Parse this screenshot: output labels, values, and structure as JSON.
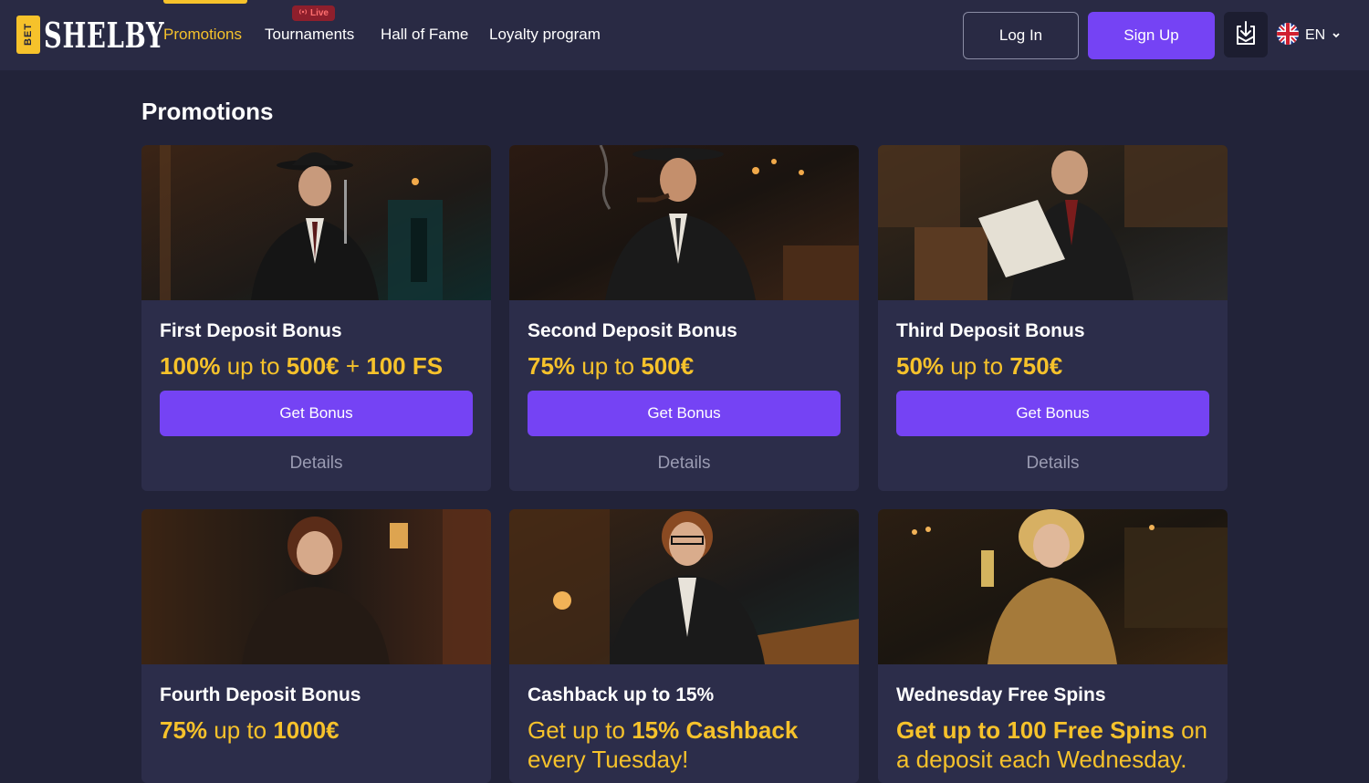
{
  "header": {
    "logo_text": "SHELBY",
    "logo_bet": "BET",
    "nav": [
      {
        "label": "Promotions",
        "active": true
      },
      {
        "label": "Tournaments",
        "badge": "Live"
      },
      {
        "label": "Hall of Fame"
      },
      {
        "label": "Loyalty program"
      }
    ],
    "login_label": "Log In",
    "signup_label": "Sign Up",
    "language": "EN"
  },
  "page": {
    "title": "Promotions"
  },
  "promos": [
    {
      "title": "First Deposit Bonus",
      "offer_parts": [
        [
          "b",
          "100%"
        ],
        [
          "n",
          " up to "
        ],
        [
          "b",
          "500€"
        ],
        [
          "n",
          " + "
        ],
        [
          "b",
          "100 FS"
        ]
      ],
      "button": "Get Bonus",
      "details": "Details"
    },
    {
      "title": "Second Deposit Bonus",
      "offer_parts": [
        [
          "b",
          "75%"
        ],
        [
          "n",
          " up to "
        ],
        [
          "b",
          "500€"
        ]
      ],
      "button": "Get Bonus",
      "details": "Details"
    },
    {
      "title": "Third Deposit Bonus",
      "offer_parts": [
        [
          "b",
          "50%"
        ],
        [
          "n",
          " up to "
        ],
        [
          "b",
          "750€"
        ]
      ],
      "button": "Get Bonus",
      "details": "Details"
    },
    {
      "title": "Fourth Deposit Bonus",
      "offer_parts": [
        [
          "b",
          "75%"
        ],
        [
          "n",
          " up to "
        ],
        [
          "b",
          "1000€"
        ]
      ]
    },
    {
      "title": "Cashback up to 15%",
      "offer_parts": [
        [
          "n",
          "Get up to "
        ],
        [
          "b",
          "15% Cashback"
        ],
        [
          "n",
          " every Tuesday!"
        ]
      ]
    },
    {
      "title": "Wednesday Free Spins",
      "offer_parts": [
        [
          "b",
          "Get up to 100 Free Spins"
        ],
        [
          "n",
          " on a deposit each Wednesday."
        ]
      ]
    }
  ],
  "colors": {
    "accent_yellow": "#f6c22b",
    "accent_purple": "#7543f4",
    "background": "#222339",
    "card": "#2c2d4a"
  }
}
